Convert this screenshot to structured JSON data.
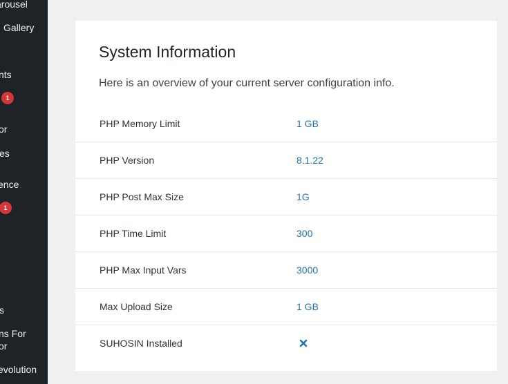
{
  "sidebar": {
    "items": [
      {
        "label": "arousel"
      },
      {
        "label": "Gallery"
      },
      {
        "label": "nts"
      },
      {
        "label": "or"
      },
      {
        "label": "es"
      },
      {
        "label": "ence"
      },
      {
        "label": "s"
      },
      {
        "label": "ns For"
      },
      {
        "label": "or"
      },
      {
        "label": "evolution"
      }
    ],
    "badges": [
      "1",
      "1"
    ]
  },
  "card": {
    "title": "System Information",
    "description": "Here is an overview of your current server configuration info."
  },
  "rows": [
    {
      "label": "PHP Memory Limit",
      "value": "1 GB"
    },
    {
      "label": "PHP Version",
      "value": "8.1.22"
    },
    {
      "label": "PHP Post Max Size",
      "value": "1G"
    },
    {
      "label": "PHP Time Limit",
      "value": "300"
    },
    {
      "label": "PHP Max Input Vars",
      "value": "3000"
    },
    {
      "label": "Max Upload Size",
      "value": "1 GB"
    },
    {
      "label": "SUHOSIN Installed",
      "value_icon": "cross-icon"
    }
  ],
  "colors": {
    "sidebar_bg": "#1d2327",
    "badge": "#d63638",
    "value_link": "#2271b1",
    "page_bg": "#f0f0f1"
  }
}
